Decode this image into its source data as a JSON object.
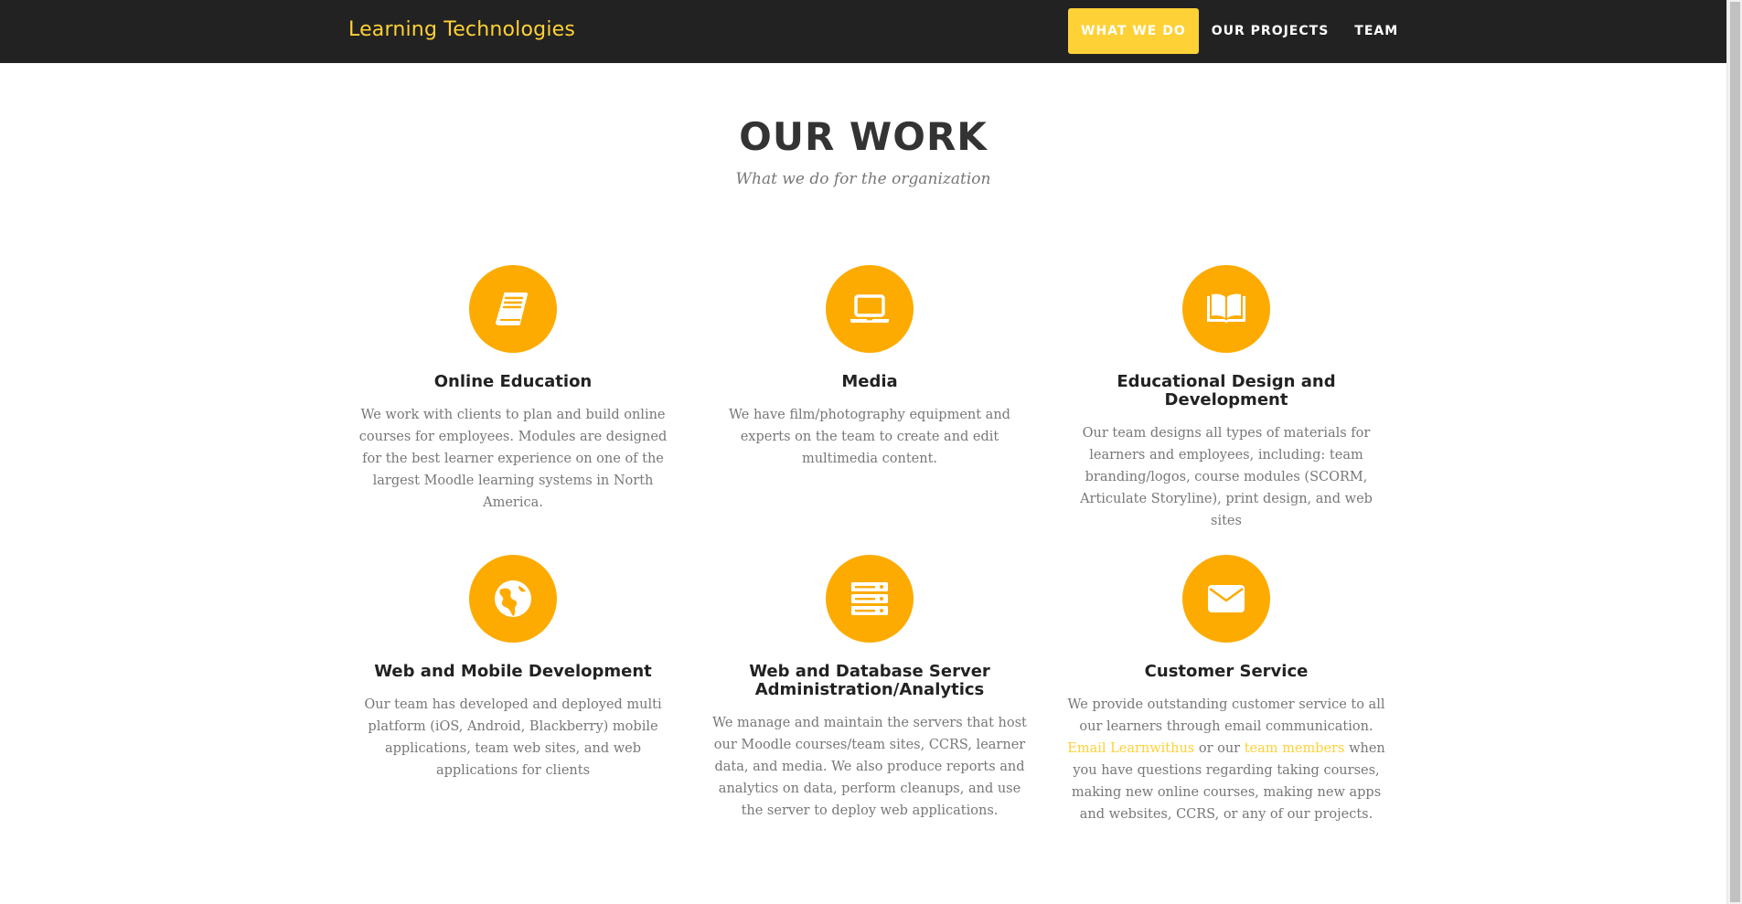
{
  "navbar": {
    "brand": "Learning Technologies",
    "items": [
      {
        "label": "WHAT WE DO",
        "active": true
      },
      {
        "label": "OUR PROJECTS",
        "active": false
      },
      {
        "label": "TEAM",
        "active": false
      }
    ]
  },
  "section": {
    "heading": "OUR WORK",
    "subheading": "What we do for the organization"
  },
  "services": [
    {
      "icon": "book-icon",
      "title": "Online Education",
      "text": "We work with clients to plan and build online courses for employees. Modules are designed for the best learner experience on one of the largest Moodle learning systems in North America."
    },
    {
      "icon": "laptop-icon",
      "title": "Media",
      "text": "We have film/photography equipment and experts on the team to create and edit multimedia content."
    },
    {
      "icon": "open-book-icon",
      "title": "Educational Design and Development",
      "text": "Our team designs all types of materials for learners and employees, including: team branding/logos, course modules (SCORM, Articulate Storyline), print design, and web sites"
    },
    {
      "icon": "globe-icon",
      "title": "Web and Mobile Development",
      "text": "Our team has developed and deployed multi platform (iOS, Android, Blackberry) mobile applications, team web sites, and web applications for clients"
    },
    {
      "icon": "server-icon",
      "title": "Web and Database Server Administration/Analytics",
      "text": "We manage and maintain the servers that host our Moodle courses/team sites, CCRS, learner data, and media. We also produce reports and analytics on data, perform cleanups, and use the server to deploy web applications."
    },
    {
      "icon": "envelope-icon",
      "title": "Customer Service",
      "text_before": "We provide outstanding customer service to all our learners through email communication.",
      "link_email": "Email Learnwithus",
      "text_middle": "or our",
      "link_team": "team members",
      "text_after": "when you have questions regarding taking courses, making new online courses, making new apps and websites, CCRS, or any of our projects."
    }
  ],
  "colors": {
    "accent": "#fed136",
    "icon_bg": "#fdab00",
    "nav_bg": "#222222"
  }
}
